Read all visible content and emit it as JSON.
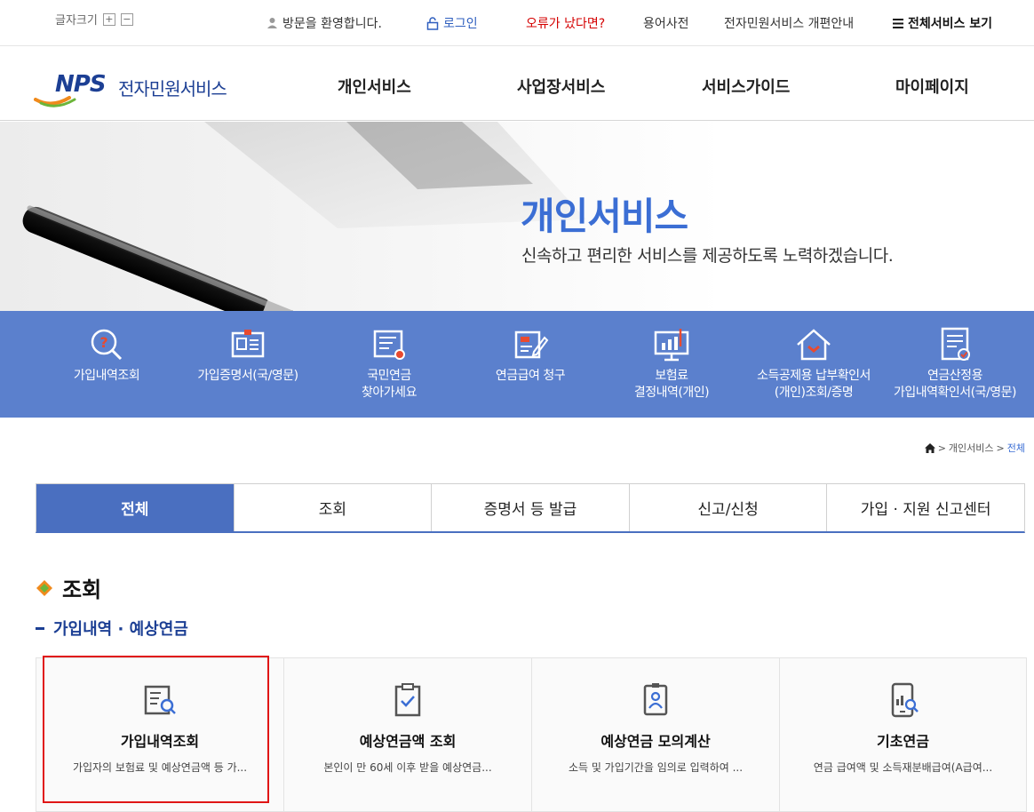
{
  "topbar": {
    "font_size_label": "글자크기",
    "font_plus": "+",
    "font_minus": "−",
    "welcome": "방문을 환영합니다.",
    "login": "로그인",
    "error_report": "오류가 났다면?",
    "glossary": "용어사전",
    "renewal_notice": "전자민원서비스 개편안내",
    "all_services": "전체서비스 보기"
  },
  "header": {
    "logo_nps": "NPS",
    "logo_service": "전자민원서비스",
    "nav": [
      "개인서비스",
      "사업장서비스",
      "서비스가이드",
      "마이페이지"
    ]
  },
  "hero": {
    "title": "개인서비스",
    "subtitle": "신속하고 편리한 서비스를 제공하도록 노력하겠습니다."
  },
  "quick_menu": [
    {
      "label": "가입내역조회",
      "icon": "search-question-icon"
    },
    {
      "label": "가입증명서(국/영문)",
      "icon": "id-certificate-icon"
    },
    {
      "label": "국민연금\n찾아가세요",
      "icon": "document-search-icon"
    },
    {
      "label": "연금급여 청구",
      "icon": "document-edit-icon"
    },
    {
      "label": "보험료\n결정내역(개인)",
      "icon": "monitor-chart-icon"
    },
    {
      "label": "소득공제용 납부확인서\n(개인)조회/증명",
      "icon": "house-icon"
    },
    {
      "label": "연금산정용\n가입내역확인서(국/영문)",
      "icon": "document-check-icon"
    }
  ],
  "breadcrumb": {
    "home_icon": "home-icon",
    "level1": "개인서비스",
    "current": "전체"
  },
  "tabs": [
    {
      "label": "전체",
      "active": true
    },
    {
      "label": "조회",
      "active": false
    },
    {
      "label": "증명서 등 발급",
      "active": false
    },
    {
      "label": "신고/신청",
      "active": false
    },
    {
      "label": "가입 · 지원 신고센터",
      "active": false
    }
  ],
  "section": {
    "title": "조회",
    "subtitle": "가입내역 · 예상연금"
  },
  "cards": [
    {
      "title": "가입내역조회",
      "desc": "가입자의 보험료 및 예상연금액 등 가...",
      "icon": "document-search-icon"
    },
    {
      "title": "예상연금액 조회",
      "desc": "본인이 만 60세 이후 받을 예상연금...",
      "icon": "clipboard-check-icon"
    },
    {
      "title": "예상연금 모의계산",
      "desc": "소득 및 가입기간을 임의로 입력하여 ...",
      "icon": "person-badge-icon"
    },
    {
      "title": "기초연금",
      "desc": "연금 급여액 및 소득재분배급여(A급여...",
      "icon": "mobile-chart-icon"
    }
  ],
  "colors": {
    "brand_blue": "#3b6ed4",
    "quick_band": "#5b80cd",
    "tab_active": "#4a6fc0",
    "highlight_red": "#e01515"
  }
}
